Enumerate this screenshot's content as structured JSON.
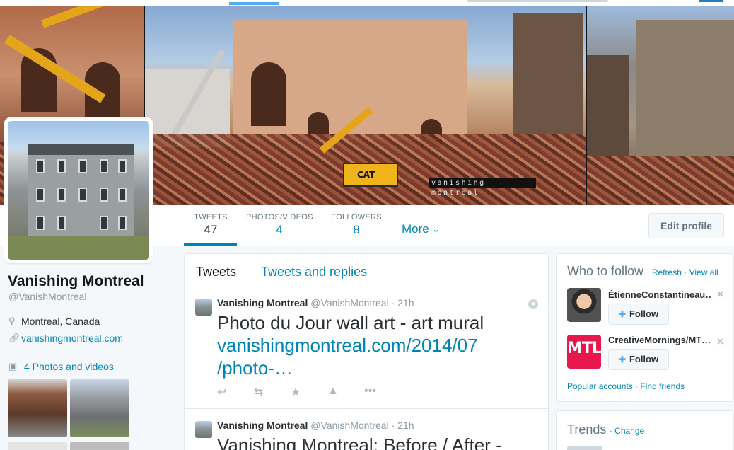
{
  "banner": {
    "watermark": "vanishing montreal",
    "cat_label": "CAT"
  },
  "stats": [
    {
      "label": "TWEETS",
      "value": "47"
    },
    {
      "label": "PHOTOS/VIDEOS",
      "value": "4"
    },
    {
      "label": "FOLLOWERS",
      "value": "8"
    }
  ],
  "stats_more": "More",
  "edit_profile": "Edit profile",
  "profile": {
    "name": "Vanishing Montreal",
    "handle": "@VanishMontreal",
    "location": "Montreal, Canada",
    "website": "vanishingmontreal.com",
    "photos_link": "4 Photos and videos"
  },
  "timeline": {
    "tabs": [
      "Tweets",
      "Tweets and replies"
    ],
    "tweets": [
      {
        "name": "Vanishing Montreal",
        "handle": "@VanishMontreal",
        "time": "· 21h",
        "text": "Photo du Jour wall art - art mural",
        "link1": "vanishingmontreal.com/2014/07",
        "link2": "/photo-…"
      },
      {
        "name": "Vanishing Montreal",
        "handle": "@VanishMontreal",
        "time": "· 21h",
        "text": "Vanishing Montreal: Before / After -"
      }
    ]
  },
  "who_to_follow": {
    "title": "Who to follow",
    "sep": "·",
    "refresh": "Refresh",
    "view_all": "View all",
    "suggestions": [
      {
        "name": "ÉtienneConstantineau…",
        "follow": "Follow"
      },
      {
        "name": "CreativeMornings/MT…",
        "follow": "Follow",
        "avatar_text": "MTL"
      }
    ],
    "popular": "Popular accounts",
    "find_friends": "Find friends"
  },
  "trends": {
    "title": "Trends",
    "change": "Change"
  },
  "icons": {
    "location": "map-pin-icon",
    "link": "link-icon",
    "camera": "camera-icon",
    "reply": "reply-icon",
    "retweet": "retweet-icon",
    "favorite": "star-icon",
    "delete": "trash-icon",
    "more": "more-icon",
    "close": "close-icon",
    "follow": "add-user-icon",
    "globe": "globe-icon"
  },
  "colors": {
    "link": "#0084b4",
    "accent": "#55acee",
    "text": "#292f33",
    "muted": "#8899a6"
  }
}
